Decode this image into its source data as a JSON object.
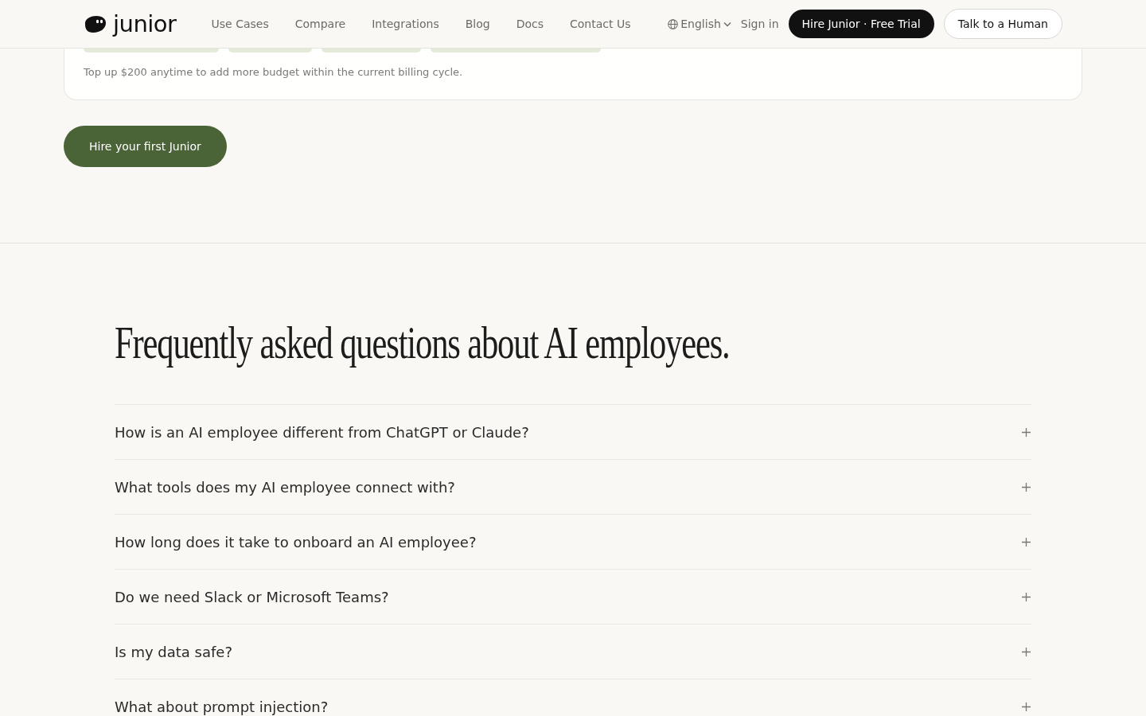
{
  "header": {
    "logo": "junior",
    "nav": [
      "Use Cases",
      "Compare",
      "Integrations",
      "Blog",
      "Docs",
      "Contact Us"
    ],
    "language": "English",
    "sign_in": "Sign in",
    "primary_button": "Hire Junior · Free Trial",
    "secondary_button": "Talk to a Human"
  },
  "pricing_card": {
    "note": "Top up $200 anytime to add more budget within the current billing cycle."
  },
  "cta_button": "Hire your first Junior",
  "faq": {
    "title": "Frequently asked questions about AI employees.",
    "items": [
      {
        "question": "How is an AI employee different from ChatGPT or Claude?",
        "expanded": false
      },
      {
        "question": "What tools does my AI employee connect with?",
        "expanded": false
      },
      {
        "question": "How long does it take to onboard an AI employee?",
        "expanded": false
      },
      {
        "question": "Do we need Slack or Microsoft Teams?",
        "expanded": false
      },
      {
        "question": "Is my data safe?",
        "expanded": false
      },
      {
        "question": "What about prompt injection?",
        "expanded": false
      }
    ]
  }
}
